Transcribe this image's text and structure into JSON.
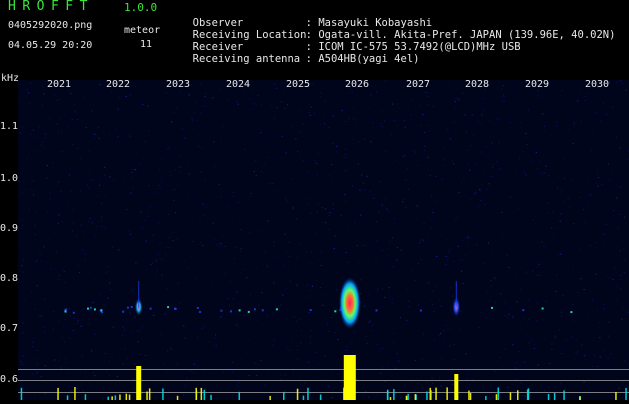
{
  "header": {
    "app_title": "HROFFT",
    "version": "1.0.0",
    "filename": "0405292020.png",
    "datetime": "04.05.29 20:20",
    "meteor_label": "meteor",
    "meteor_count": "11"
  },
  "info": [
    {
      "label": "Observer",
      "value": "Masayuki Kobayashi"
    },
    {
      "label": "Receiving Location",
      "value": "Ogata-vill. Akita-Pref. JAPAN (139.96E, 40.02N)"
    },
    {
      "label": "Receiver",
      "value": "ICOM IC-575 53.7492(@LCD)MHz USB"
    },
    {
      "label": "Receiving antenna",
      "value": "A504HB(yagi 4el)"
    }
  ],
  "chart_data": {
    "type": "heatmap",
    "title": "",
    "xlabel": "",
    "ylabel": "kHz",
    "x_ticks": [
      "2021",
      "2022",
      "2023",
      "2024",
      "2025",
      "2026",
      "2027",
      "2028",
      "2029",
      "2030"
    ],
    "y_ticks": [
      "1.1",
      "1.0",
      "0.9",
      "0.8",
      "0.7",
      "0.6"
    ],
    "ylim": [
      0.58,
      1.18
    ],
    "signal_band_khz": 0.74,
    "meteor_echoes": [
      {
        "x": "2022.35",
        "strength": "medium"
      },
      {
        "x": "2025.88",
        "strength": "strong"
      },
      {
        "x": "2027.66",
        "strength": "weak"
      }
    ],
    "colors": {
      "background": "#00051c",
      "weak": "#1030ff",
      "medium": "#00e0a0",
      "strong": "#ff2060",
      "level": "#ffff00"
    }
  }
}
